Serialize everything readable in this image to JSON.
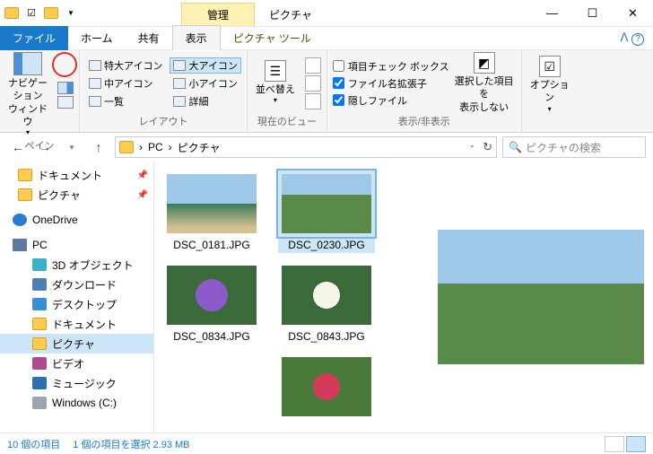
{
  "titlebar": {
    "context_tab": "管理",
    "window_title": "ピクチャ"
  },
  "ribbon_tabs": {
    "file": "ファイル",
    "home": "ホーム",
    "share": "共有",
    "view": "表示",
    "picture_tools": "ピクチャ ツール"
  },
  "ribbon": {
    "pane": {
      "nav_pane": "ナビゲーション\nウィンドウ",
      "label": "ペイン"
    },
    "layout": {
      "extra_large": "特大アイコン",
      "large": "大アイコン",
      "medium": "中アイコン",
      "small": "小アイコン",
      "list": "一覧",
      "details": "詳細",
      "label": "レイアウト"
    },
    "current_view": {
      "sort": "並べ替え",
      "label": "現在のビュー"
    },
    "show_hide": {
      "item_check": "項目チェック ボックス",
      "filename_ext": "ファイル名拡張子",
      "hidden_files": "隠しファイル",
      "hide_selected": "選択した項目を\n表示しない",
      "label": "表示/非表示"
    },
    "options": "オプション"
  },
  "address": {
    "pc": "PC",
    "pictures": "ピクチャ",
    "search_placeholder": "ピクチャの検索"
  },
  "tree": {
    "documents": "ドキュメント",
    "pictures": "ピクチャ",
    "onedrive": "OneDrive",
    "pc": "PC",
    "objects3d": "3D オブジェクト",
    "downloads": "ダウンロード",
    "desktop": "デスクトップ",
    "documents2": "ドキュメント",
    "pictures2": "ピクチャ",
    "video": "ビデオ",
    "music": "ミュージック",
    "windows_c": "Windows (C:)"
  },
  "files": [
    "DSC_0181.JPG",
    "DSC_0230.JPG",
    "DSC_0834.JPG",
    "DSC_0843.JPG"
  ],
  "status": {
    "item_count": "10 個の項目",
    "selection": "1 個の項目を選択 2.93 MB"
  }
}
